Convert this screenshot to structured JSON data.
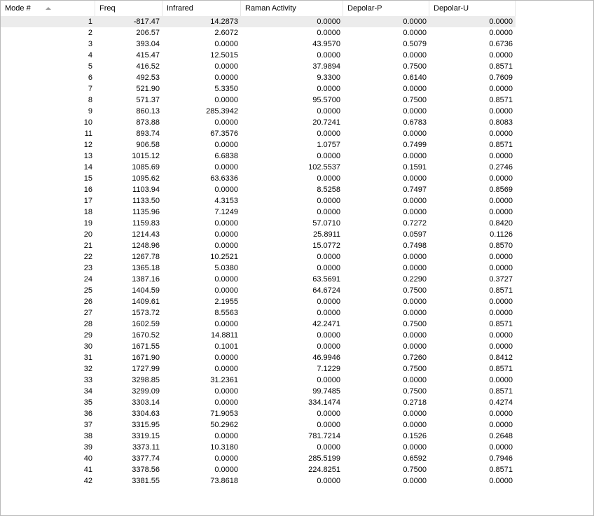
{
  "columns": [
    "Mode #",
    "Freq",
    "Infrared",
    "Raman Activity",
    "Depolar-P",
    "Depolar-U"
  ],
  "rows": [
    [
      "1",
      "-817.47",
      "14.2873",
      "0.0000",
      "0.0000",
      "0.0000"
    ],
    [
      "2",
      "206.57",
      "2.6072",
      "0.0000",
      "0.0000",
      "0.0000"
    ],
    [
      "3",
      "393.04",
      "0.0000",
      "43.9570",
      "0.5079",
      "0.6736"
    ],
    [
      "4",
      "415.47",
      "12.5015",
      "0.0000",
      "0.0000",
      "0.0000"
    ],
    [
      "5",
      "416.52",
      "0.0000",
      "37.9894",
      "0.7500",
      "0.8571"
    ],
    [
      "6",
      "492.53",
      "0.0000",
      "9.3300",
      "0.6140",
      "0.7609"
    ],
    [
      "7",
      "521.90",
      "5.3350",
      "0.0000",
      "0.0000",
      "0.0000"
    ],
    [
      "8",
      "571.37",
      "0.0000",
      "95.5700",
      "0.7500",
      "0.8571"
    ],
    [
      "9",
      "860.13",
      "285.3942",
      "0.0000",
      "0.0000",
      "0.0000"
    ],
    [
      "10",
      "873.88",
      "0.0000",
      "20.7241",
      "0.6783",
      "0.8083"
    ],
    [
      "11",
      "893.74",
      "67.3576",
      "0.0000",
      "0.0000",
      "0.0000"
    ],
    [
      "12",
      "906.58",
      "0.0000",
      "1.0757",
      "0.7499",
      "0.8571"
    ],
    [
      "13",
      "1015.12",
      "6.6838",
      "0.0000",
      "0.0000",
      "0.0000"
    ],
    [
      "14",
      "1085.69",
      "0.0000",
      "102.5537",
      "0.1591",
      "0.2746"
    ],
    [
      "15",
      "1095.62",
      "63.6336",
      "0.0000",
      "0.0000",
      "0.0000"
    ],
    [
      "16",
      "1103.94",
      "0.0000",
      "8.5258",
      "0.7497",
      "0.8569"
    ],
    [
      "17",
      "1133.50",
      "4.3153",
      "0.0000",
      "0.0000",
      "0.0000"
    ],
    [
      "18",
      "1135.96",
      "7.1249",
      "0.0000",
      "0.0000",
      "0.0000"
    ],
    [
      "19",
      "1159.83",
      "0.0000",
      "57.0710",
      "0.7272",
      "0.8420"
    ],
    [
      "20",
      "1214.43",
      "0.0000",
      "25.8911",
      "0.0597",
      "0.1126"
    ],
    [
      "21",
      "1248.96",
      "0.0000",
      "15.0772",
      "0.7498",
      "0.8570"
    ],
    [
      "22",
      "1267.78",
      "10.2521",
      "0.0000",
      "0.0000",
      "0.0000"
    ],
    [
      "23",
      "1365.18",
      "5.0380",
      "0.0000",
      "0.0000",
      "0.0000"
    ],
    [
      "24",
      "1387.16",
      "0.0000",
      "63.5691",
      "0.2290",
      "0.3727"
    ],
    [
      "25",
      "1404.59",
      "0.0000",
      "64.6724",
      "0.7500",
      "0.8571"
    ],
    [
      "26",
      "1409.61",
      "2.1955",
      "0.0000",
      "0.0000",
      "0.0000"
    ],
    [
      "27",
      "1573.72",
      "8.5563",
      "0.0000",
      "0.0000",
      "0.0000"
    ],
    [
      "28",
      "1602.59",
      "0.0000",
      "42.2471",
      "0.7500",
      "0.8571"
    ],
    [
      "29",
      "1670.52",
      "14.8811",
      "0.0000",
      "0.0000",
      "0.0000"
    ],
    [
      "30",
      "1671.55",
      "0.1001",
      "0.0000",
      "0.0000",
      "0.0000"
    ],
    [
      "31",
      "1671.90",
      "0.0000",
      "46.9946",
      "0.7260",
      "0.8412"
    ],
    [
      "32",
      "1727.99",
      "0.0000",
      "7.1229",
      "0.7500",
      "0.8571"
    ],
    [
      "33",
      "3298.85",
      "31.2361",
      "0.0000",
      "0.0000",
      "0.0000"
    ],
    [
      "34",
      "3299.09",
      "0.0000",
      "99.7485",
      "0.7500",
      "0.8571"
    ],
    [
      "35",
      "3303.14",
      "0.0000",
      "334.1474",
      "0.2718",
      "0.4274"
    ],
    [
      "36",
      "3304.63",
      "71.9053",
      "0.0000",
      "0.0000",
      "0.0000"
    ],
    [
      "37",
      "3315.95",
      "50.2962",
      "0.0000",
      "0.0000",
      "0.0000"
    ],
    [
      "38",
      "3319.15",
      "0.0000",
      "781.7214",
      "0.1526",
      "0.2648"
    ],
    [
      "39",
      "3373.11",
      "10.3180",
      "0.0000",
      "0.0000",
      "0.0000"
    ],
    [
      "40",
      "3377.74",
      "0.0000",
      "285.5199",
      "0.6592",
      "0.7946"
    ],
    [
      "41",
      "3378.56",
      "0.0000",
      "224.8251",
      "0.7500",
      "0.8571"
    ],
    [
      "42",
      "3381.55",
      "73.8618",
      "0.0000",
      "0.0000",
      "0.0000"
    ]
  ],
  "icons": {
    "sort": "sort-ascending-icon"
  },
  "colors": {
    "selected_row": "#ececec",
    "grid_line": "#e5e5e5"
  }
}
